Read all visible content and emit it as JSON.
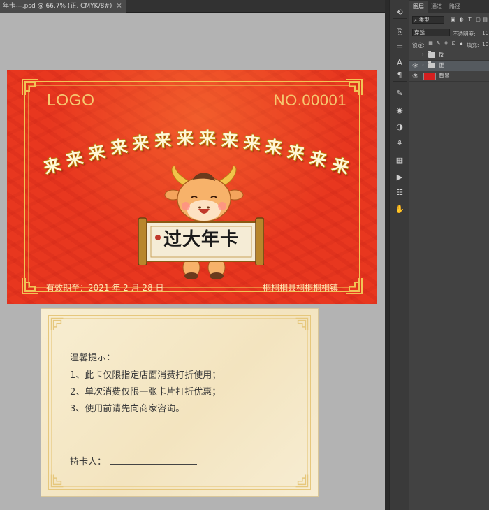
{
  "document_tab": {
    "title": "年卡---.psd @ 66.7% (正, CMYK/8#)",
    "close": "×"
  },
  "layers_panel": {
    "tabs": [
      "图层",
      "通道",
      "路径"
    ],
    "filter_kind": "类型",
    "blend_mode": "穿透",
    "opacity_label": "不透明度:",
    "opacity_value": "10",
    "lock_label": "锁定:",
    "fill_label": "填充:",
    "fill_value": "10",
    "layers": [
      {
        "name": "反",
        "type": "group",
        "visible": false
      },
      {
        "name": "正",
        "type": "group",
        "visible": true,
        "selected": true
      },
      {
        "name": "背景",
        "type": "layer",
        "visible": true,
        "thumb_color": "#d41f1f"
      }
    ]
  },
  "tool_icons": [
    "history-icon",
    "transform-icon",
    "adjust-sliders-icon",
    "character-icon",
    "paragraph-icon",
    "brush-icon",
    "styles-icon",
    "color-icon",
    "swatches-icon",
    "grid-icon",
    "play-icon",
    "properties-icon",
    "puppet-icon"
  ],
  "card_front": {
    "logo": "LOGO",
    "number": "NO.00001",
    "lai_chars": [
      "来",
      "来",
      "来",
      "来",
      "来",
      "来",
      "来",
      "来",
      "来",
      "来",
      "来",
      "来",
      "来",
      "来"
    ],
    "scroll_title": "过大年卡",
    "validity": "有效期至：2021 年 2 月 28 日",
    "address": "桐桐桐县桐桐桐桐镇",
    "colors": {
      "red": "#e8371f",
      "gold": "#f1c456"
    }
  },
  "card_back": {
    "heading": "温馨提示：",
    "rules": [
      "1、此卡仅限指定店面消费打折使用；",
      "2、单次消费仅限一张卡片打折优惠；",
      "3、使用前请先向商家咨询。"
    ],
    "holder_label": "持卡人："
  }
}
